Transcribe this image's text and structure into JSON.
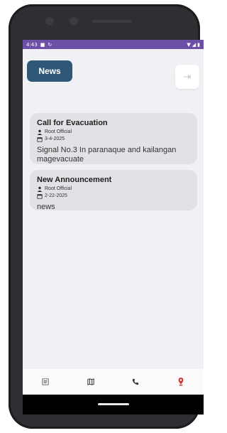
{
  "status_bar": {
    "time": "4:43",
    "icons_left": [
      "notification-square-icon",
      "sync-icon"
    ],
    "icons_right": [
      "wifi-icon",
      "signal-icon",
      "battery-icon"
    ]
  },
  "header": {
    "title": "News",
    "logout_icon": "logout-icon"
  },
  "cards": [
    {
      "title": "Call for Evacuation",
      "author": "Root Official",
      "date": "3-4-2025",
      "body": "Signal No.3 In paranaque and kailangan magevacuate"
    },
    {
      "title": "New Announcement",
      "author": "Root Official",
      "date": "2-22-2025",
      "body": "news"
    }
  ],
  "bottom_nav": {
    "items": [
      "news-icon",
      "map-icon",
      "phone-icon",
      "location-alert-icon"
    ],
    "active_color": "#d32f2f"
  },
  "colors": {
    "status_bar": "#6c4fa6",
    "header_button": "#2f5877",
    "card_bg": "#e2e1e5",
    "screen_bg": "#f1f0f4"
  }
}
